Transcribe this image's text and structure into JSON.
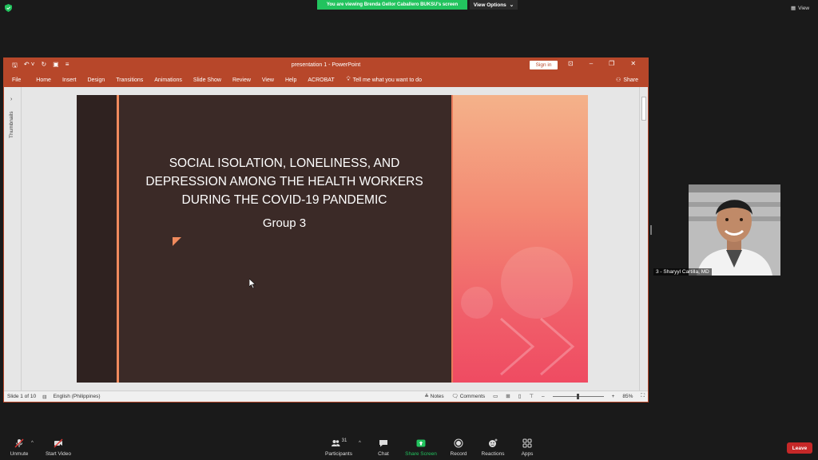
{
  "zoom": {
    "share_banner": "You are viewing Brenda Gellor Caballero BUKSU's screen",
    "view_options": "View Options",
    "view_button": "View",
    "toolbar": {
      "unmute": "Unmute",
      "start_video": "Start Video",
      "participants": "Participants",
      "participants_count": "31",
      "chat": "Chat",
      "share_screen": "Share Screen",
      "record": "Record",
      "reactions": "Reactions",
      "apps": "Apps",
      "leave": "Leave"
    },
    "participant_name": "3 - Sharyyl Cartilla, MD"
  },
  "ppt": {
    "title": "presentation 1  -  PowerPoint",
    "sign_in": "Sign in",
    "tabs": [
      "File",
      "Home",
      "Insert",
      "Design",
      "Transitions",
      "Animations",
      "Slide Show",
      "Review",
      "View",
      "Help",
      "ACROBAT"
    ],
    "tell_me": "Tell me what you want to do",
    "share": "Share",
    "thumbnails_label": "Thumbnails",
    "status": {
      "slide": "Slide 1 of 10",
      "language": "English (Philippines)",
      "notes": "Notes",
      "comments": "Comments",
      "zoom": "85%"
    },
    "slide": {
      "title_line1": "SOCIAL ISOLATION, LONELINESS, AND",
      "title_line2": "DEPRESSION AMONG THE HEALTH WORKERS",
      "title_line3": "DURING THE COVID-19 PANDEMIC",
      "subtitle": "Group 3"
    }
  },
  "colors": {
    "ppt_accent": "#b7472a",
    "share_green": "#22c35e",
    "leave_red": "#c62828",
    "share_screen_icon": "#22c35e"
  }
}
